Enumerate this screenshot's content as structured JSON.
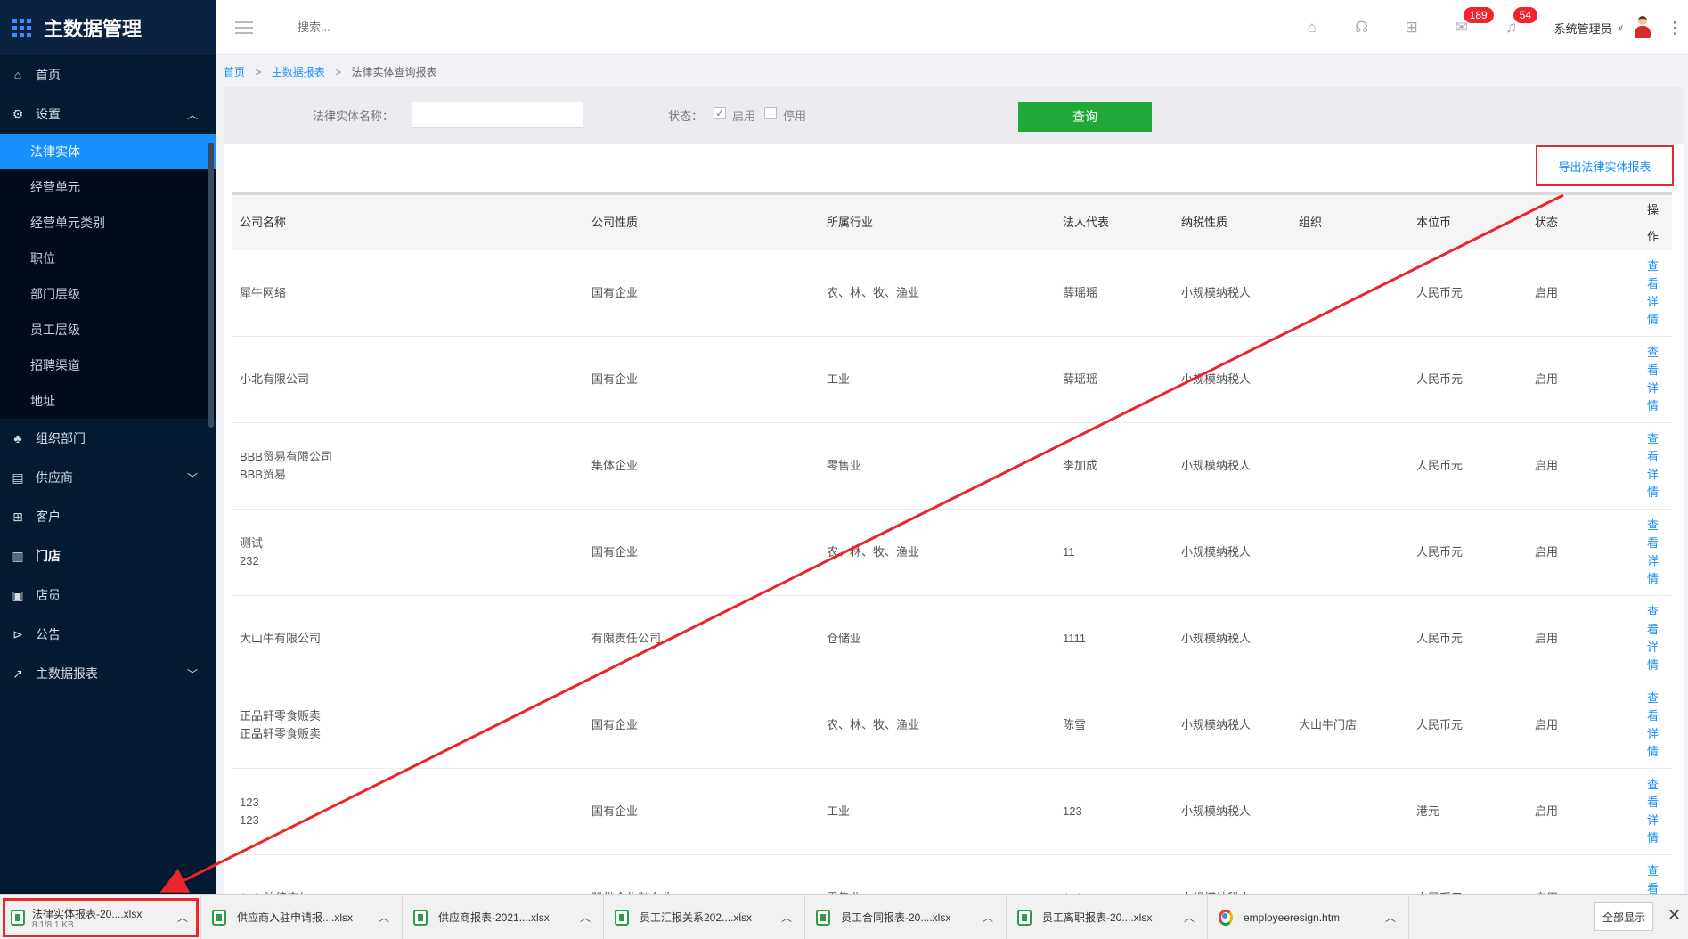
{
  "app": {
    "title": "主数据管理"
  },
  "sidebar": {
    "items": [
      {
        "label": "首页",
        "icon": "home-icon"
      },
      {
        "label": "设置",
        "icon": "gear-icon",
        "expanded": true,
        "children": [
          "法律实体",
          "经营单元",
          "经营单元类别",
          "职位",
          "部门层级",
          "员工层级",
          "招聘渠道",
          "地址"
        ],
        "active_child": "法律实体"
      },
      {
        "label": "组织部门",
        "icon": "org-icon"
      },
      {
        "label": "供应商",
        "icon": "supplier-icon",
        "expandable": true
      },
      {
        "label": "客户",
        "icon": "customer-icon"
      },
      {
        "label": "门店",
        "icon": "store-icon"
      },
      {
        "label": "店员",
        "icon": "staff-icon"
      },
      {
        "label": "公告",
        "icon": "announce-icon"
      },
      {
        "label": "主数据报表",
        "icon": "chart-icon",
        "expandable": true
      }
    ]
  },
  "header": {
    "search_placeholder": "搜索...",
    "badges": {
      "mail": "189",
      "bell": "54"
    },
    "user_name": "系统管理员"
  },
  "breadcrumb": {
    "home": "首页",
    "report": "主数据报表",
    "current": "法律实体查询报表",
    "sep": ">"
  },
  "filter": {
    "name_label": "法律实体名称：",
    "name_value": "",
    "status_label": "状态：",
    "enabled_label": "启用",
    "enabled_checked": true,
    "disabled_label": "停用",
    "disabled_checked": false,
    "query_button": "查询"
  },
  "export_button": "导出法律实体报表",
  "table": {
    "headers": {
      "name": "公司名称",
      "nature": "公司性质",
      "industry": "所属行业",
      "legal": "法人代表",
      "tax": "纳税性质",
      "org": "组织",
      "currency": "本位币",
      "state": "状态",
      "op": "操作"
    },
    "op_label": "查看详情",
    "rows": [
      {
        "name": "犀牛网络",
        "nature": "国有企业",
        "industry": "农、林、牧、渔业",
        "legal": "薛瑶瑶",
        "tax": "小规模纳税人",
        "org": "",
        "currency": "人民币元",
        "state": "启用"
      },
      {
        "name": "小北有限公司",
        "nature": "国有企业",
        "industry": "工业",
        "legal": "薛瑶瑶",
        "tax": "小规模纳税人",
        "org": "",
        "currency": "人民币元",
        "state": "启用"
      },
      {
        "name": "BBB贸易有限公司\nBBB贸易",
        "nature": "集体企业",
        "industry": "零售业",
        "legal": "李加成",
        "tax": "小规模纳税人",
        "org": "",
        "currency": "人民币元",
        "state": "启用"
      },
      {
        "name": "测试\n232",
        "nature": "国有企业",
        "industry": "农、林、牧、渔业",
        "legal": "11",
        "tax": "小规模纳税人",
        "org": "",
        "currency": "人民币元",
        "state": "启用"
      },
      {
        "name": "大山牛有限公司",
        "nature": "有限责任公司",
        "industry": "仓储业",
        "legal": "1111",
        "tax": "小规模纳税人",
        "org": "",
        "currency": "人民币元",
        "state": "启用"
      },
      {
        "name": "正品轩零食贩卖\n正品轩零食贩卖",
        "nature": "国有企业",
        "industry": "农、林、牧、渔业",
        "legal": "陈雪",
        "tax": "小规模纳税人",
        "org": "大山牛门店",
        "currency": "人民币元",
        "state": "启用"
      },
      {
        "name": "123\n123",
        "nature": "国有企业",
        "industry": "工业",
        "legal": "123",
        "tax": "小规模纳税人",
        "org": "",
        "currency": "港元",
        "state": "启用"
      },
      {
        "name": "linda法律实体",
        "nature": "股份合作制企业",
        "industry": "零售业",
        "legal": "linda",
        "tax": "小规模纳税人",
        "org": "",
        "currency": "人民币元",
        "state": "启用"
      }
    ]
  },
  "downloads": {
    "items": [
      {
        "name": "法律实体报表-20....xlsx",
        "size": "8.1/8.1 KB",
        "type": "xlsx"
      },
      {
        "name": "供应商入驻申请报....xlsx",
        "type": "xlsx"
      },
      {
        "name": "供应商报表-2021....xlsx",
        "type": "xlsx"
      },
      {
        "name": "员工汇报关系202....xlsx",
        "type": "xlsx"
      },
      {
        "name": "员工合同报表-20....xlsx",
        "type": "xlsx"
      },
      {
        "name": "员工离职报表-20....xlsx",
        "type": "xlsx"
      },
      {
        "name": "employeeresign.htm",
        "type": "htm"
      }
    ],
    "show_all": "全部显示",
    "close": "✕"
  },
  "colors": {
    "accent": "#1890ff",
    "sidebar_bg": "#041a33",
    "query_btn": "#20a83a",
    "highlight": "#e8262b",
    "badge": "#f5222d"
  }
}
